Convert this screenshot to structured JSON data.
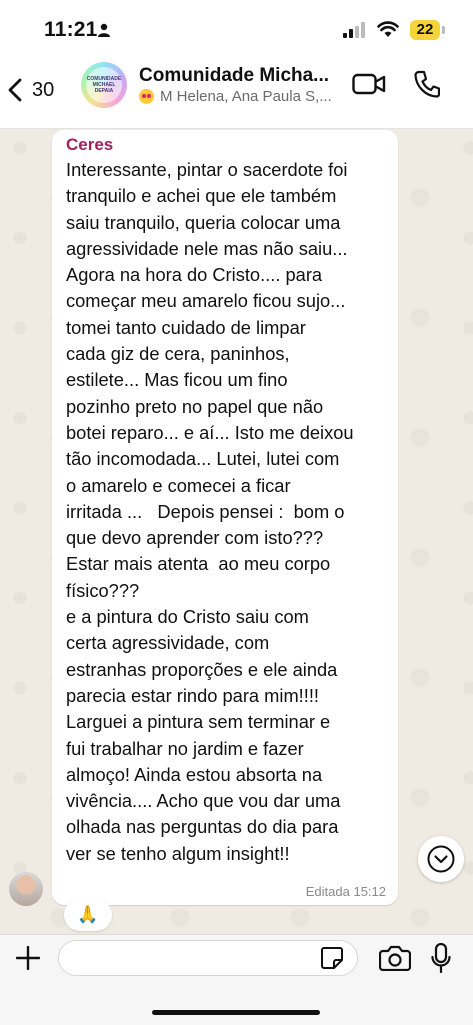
{
  "status_bar": {
    "time": "11:21",
    "battery": "22"
  },
  "header": {
    "back_count": "30",
    "group_name": "Comunidade Micha...",
    "members": "M Helena, Ana Paula S,...",
    "avatar_text": "COMUNIDADE MICHAEL DEPAIA"
  },
  "message": {
    "sender": "Ceres",
    "text": "Interessante, pintar o sacerdote foi\ntranquilo e achei que ele também\nsaiu tranquilo, queria colocar uma\nagressividade nele mas não saiu...\nAgora na hora do Cristo.... para\ncomeçar meu amarelo ficou sujo...\ntomei tanto cuidado de limpar\ncada giz de cera, paninhos,\nestilete... Mas ficou um fino\npozinho preto no papel que não\nbotei reparo... e aí... Isto me deixou\ntão incomodada... Lutei, lutei com\no amarelo e comecei a ficar\nirritada ...   Depois pensei :  bom o\nque devo aprender com isto???\nEstar mais atenta  ao meu corpo\nfísico???\ne a pintura do Cristo saiu com\ncerta agressividade, com\nestranhas proporções e ele ainda\nparecia estar rindo para mim!!!!\nLarguei a pintura sem terminar e\nfui trabalhar no jardim e fazer\nalmoço! Ainda estou absorta na\nvivência.... Acho que vou dar uma\nolhada nas perguntas do dia para\nver se tenho algum insight!!",
    "meta": "Editada  15:12",
    "reaction": "🙏"
  },
  "input": {
    "value": ""
  },
  "colors": {
    "sender": "#a0225b",
    "wallpaper": "#efeae2",
    "battery": "#f4d43a"
  },
  "icons": [
    "person-icon",
    "signal-icon",
    "wifi-icon",
    "back-chevron-icon",
    "video-call-icon",
    "voice-call-icon",
    "chevron-down-icon",
    "plus-icon",
    "sticker-icon",
    "camera-icon",
    "mic-icon"
  ]
}
